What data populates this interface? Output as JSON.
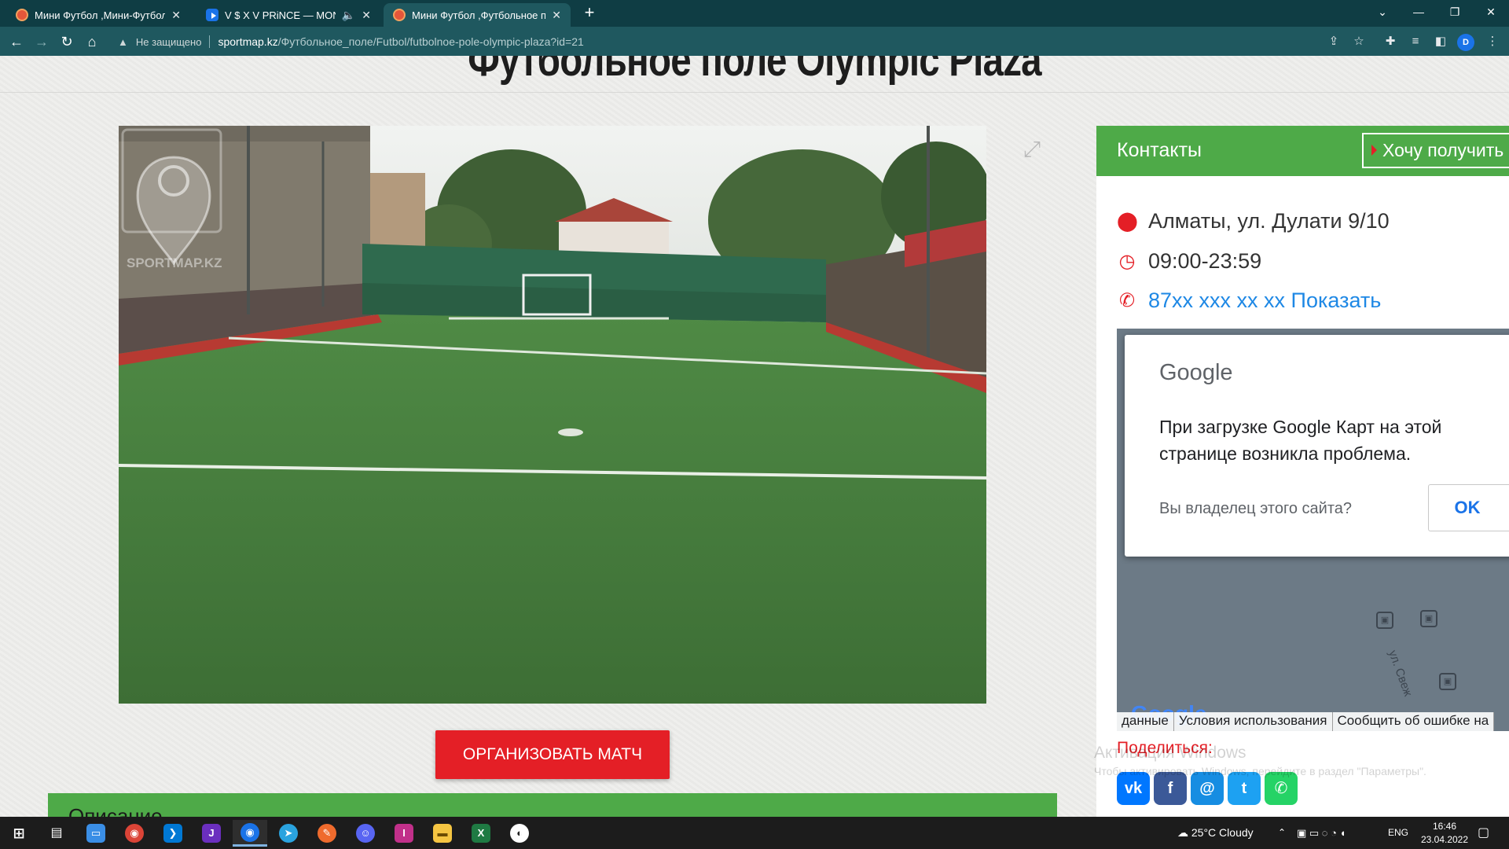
{
  "browser": {
    "tabs": [
      {
        "title": "Мини Футбол ,Мини-Футбольн",
        "close": "✕"
      },
      {
        "title": "V $ X V PRiNCE — MONEY",
        "audio": "🔈",
        "close": "✕"
      },
      {
        "title": "Мини Футбол ,Футбольное пол",
        "close": "✕"
      }
    ],
    "new_tab": "+",
    "window_controls": {
      "menu": "⌄",
      "minimize": "—",
      "restore": "❐",
      "close": "✕"
    },
    "nav": {
      "back": "←",
      "forward": "→",
      "reload": "↻",
      "home": "⌂"
    },
    "security_label": "Не защищено",
    "url_domain": "sportmap.kz",
    "url_path": "/Футбольное_поле/Futbol/futbolnoe-pole-olympic-plaza?id=21",
    "profile_letter": "D"
  },
  "page": {
    "title": "Футбольное поле Olympic Plaza",
    "photo_watermark": "SPORTMAP.KZ",
    "cta_label": "ОРГАНИЗОВАТЬ МАТЧ",
    "description_heading": "Описание"
  },
  "contacts": {
    "heading": "Контакты",
    "want_button": "Хочу получить с",
    "address": "Алматы, ул. Дулати 9/10",
    "hours": "09:00-23:59",
    "phone": "87xx xxx xx xx Показать"
  },
  "map": {
    "dialog_logo": "Google",
    "dialog_message": "При загрузке Google Карт на этой странице возникла проблема.",
    "dialog_question": "Вы владелец этого сайта?",
    "dialog_ok": "OK",
    "street_label": "ул. Свеж",
    "google_mark": "Google",
    "footer": [
      "данные",
      "Условия использования",
      "Сообщить об ошибке на"
    ]
  },
  "share": {
    "label": "Поделиться:",
    "networks": [
      "vk",
      "facebook",
      "moi-mir",
      "twitter",
      "whatsapp"
    ]
  },
  "watermark": {
    "line1": "Активация Windows",
    "line2": "Чтобы активировать Windows, перейдите в раздел \"Параметры\"."
  },
  "taskbar": {
    "weather": "25°C  Cloudy",
    "language": "ENG",
    "time": "16:46",
    "date": "23.04.2022"
  },
  "colors": {
    "accent_green": "#4eaa48",
    "cta_red": "#e41f26",
    "phone_blue": "#1e88e5",
    "browser_chrome": "#1f585f"
  }
}
